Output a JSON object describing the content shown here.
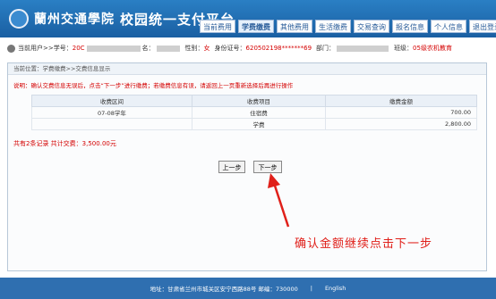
{
  "header": {
    "school_name": "蘭州交通學院",
    "title": "校园统一支付平台"
  },
  "nav": [
    "当前费用",
    "学费缴费",
    "其他费用",
    "生活缴费",
    "交易查询",
    "报名信息",
    "个人信息",
    "退出登录"
  ],
  "user": {
    "label": "当前用户>>学号：",
    "id": "20C",
    "name_label": "名：",
    "gender_label": "性别：",
    "gender": "女",
    "idcard_label": "身份证号：",
    "idcard": "620502198*******69",
    "dept_label": "部门：",
    "class_label": "班级：",
    "class": "05级农机教育"
  },
  "breadcrumb": "当前位置：学费缴费>>交费信息显示",
  "hint": "说明：确认交费信息无误后，点击“下一步”进行缴费；若缴费信息有误，请返回上一页重新选择后再进行操作",
  "table": {
    "headers": [
      "收费区间",
      "收费项目",
      "缴费金额"
    ],
    "rows": [
      {
        "period": "07-08学年",
        "item": "住宿费",
        "amount": "700.00"
      },
      {
        "period": "",
        "item": "学费",
        "amount": "2,800.00"
      }
    ]
  },
  "summary": "共有2条记录  共计交费：3,500.00元",
  "buttons": {
    "prev": "上一步",
    "next": "下一步"
  },
  "annotation": "确认金额继续点击下一步",
  "footer": {
    "address": "地址：甘肃省兰州市城关区安宁西路88号 邮编：730000",
    "separator": "|",
    "lang": "English"
  },
  "colors": {
    "header_blue": "#1f6bb0",
    "alert_red": "#d40000",
    "annotation_red": "#e0201a"
  }
}
